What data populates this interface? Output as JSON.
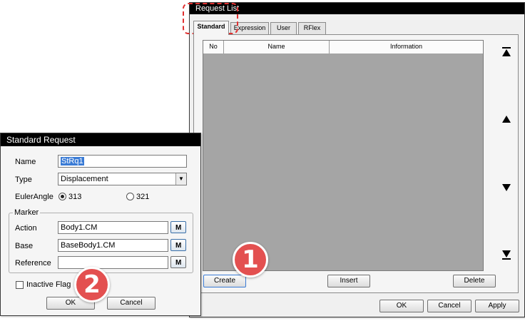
{
  "request_list": {
    "title": "Request List",
    "tabs": [
      {
        "label": "Standard"
      },
      {
        "label": "Expression"
      },
      {
        "label": "User"
      },
      {
        "label": "RFlex"
      }
    ],
    "columns": [
      {
        "label": "No"
      },
      {
        "label": "Name"
      },
      {
        "label": "Information"
      }
    ],
    "nav_icons": [
      "first-icon",
      "up-icon",
      "down-icon",
      "last-icon"
    ],
    "buttons": {
      "create": "Create",
      "insert": "Insert",
      "delete": "Delete",
      "ok": "OK",
      "cancel": "Cancel",
      "apply": "Apply"
    }
  },
  "standard_request": {
    "title": "Standard Request",
    "name_label": "Name",
    "name_value": "StRq1",
    "type_label": "Type",
    "type_value": "Displacement",
    "euler_label": "EulerAngle",
    "euler_options": [
      "313",
      "321"
    ],
    "euler_selected": "313",
    "marker_group": "Marker",
    "action_label": "Action",
    "action_value": "Body1.CM",
    "base_label": "Base",
    "base_value": "BaseBody1.CM",
    "reference_label": "Reference",
    "reference_value": "",
    "m_button": "M",
    "inactive_flag_label": "Inactive Flag",
    "inactive_flag_checked": false,
    "ok": "OK",
    "cancel": "Cancel"
  },
  "callouts": [
    "1",
    "2"
  ],
  "colors": {
    "titlebar": "#000000",
    "list_area": "#a5a5a5",
    "badge": "#e35050",
    "highlight_dash": "#e03030",
    "selection": "#3a7bd5"
  }
}
